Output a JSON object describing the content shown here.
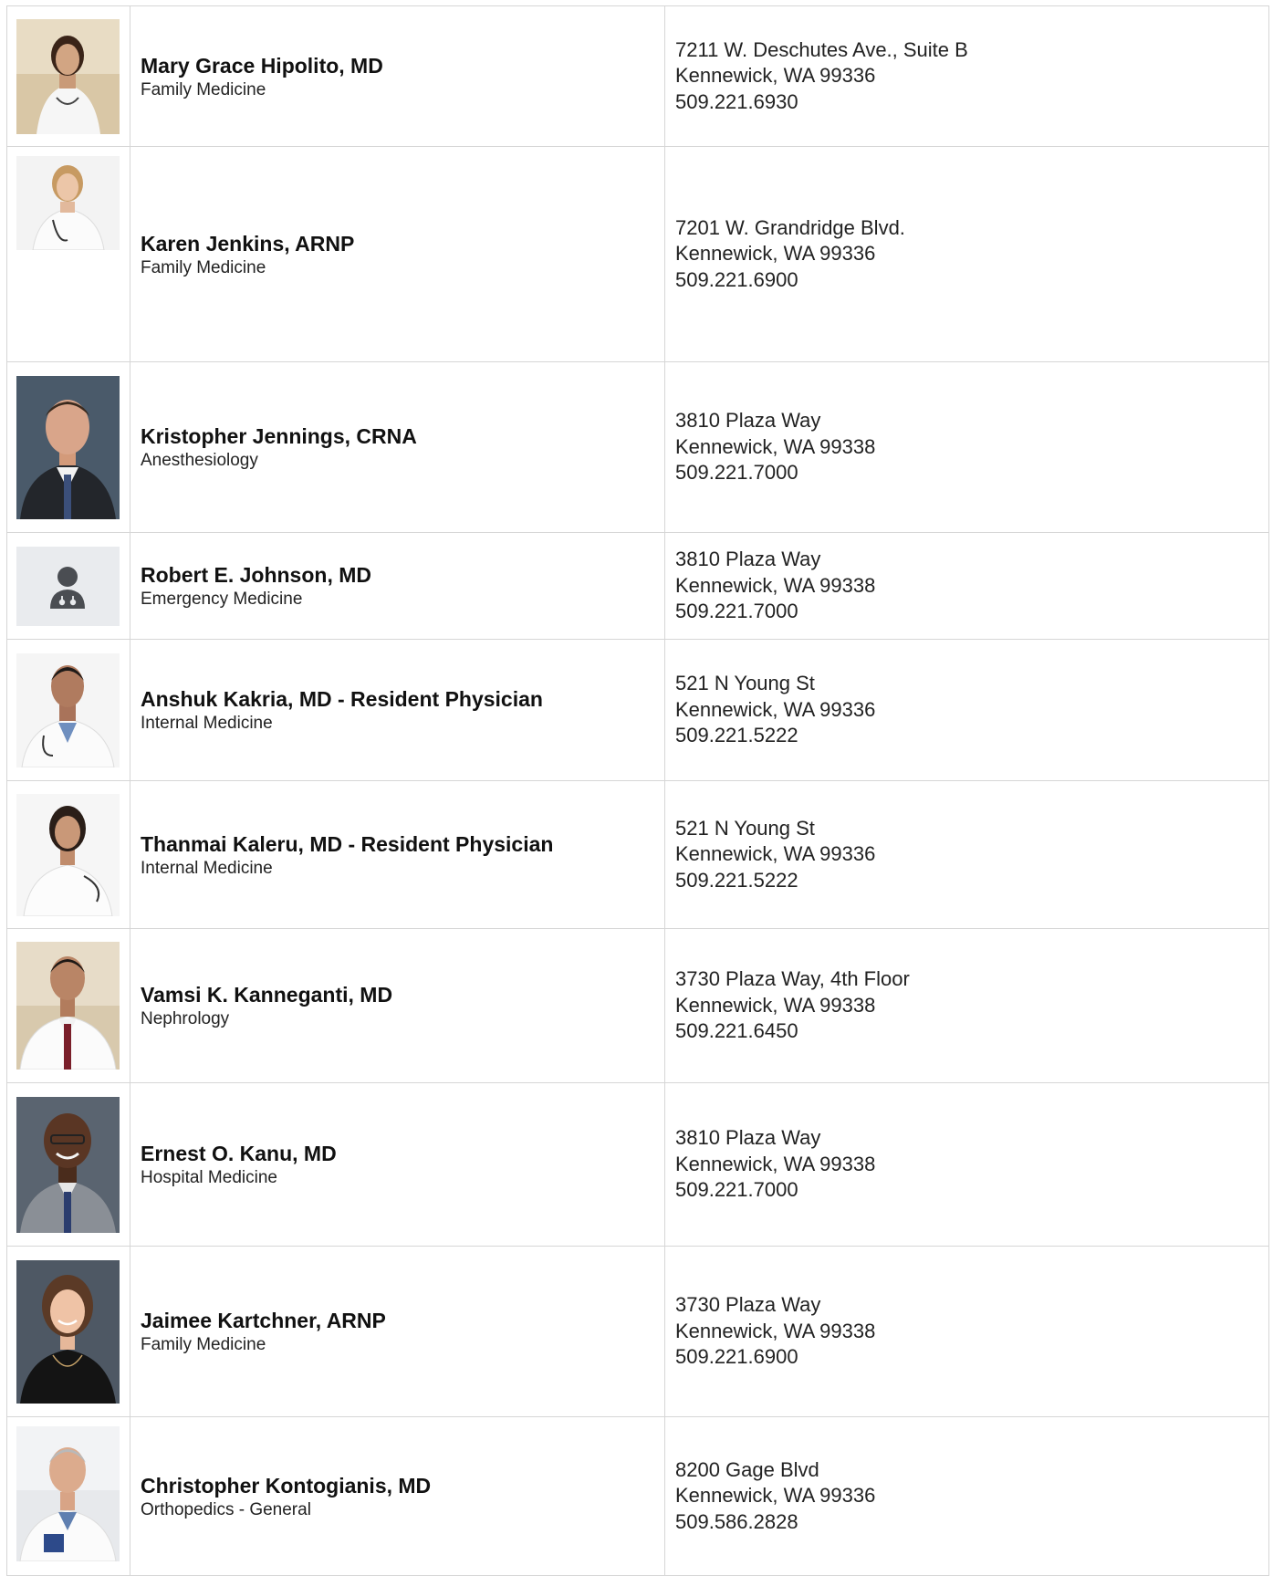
{
  "providers": [
    {
      "name": "Mary Grace Hipolito, MD",
      "specialty": "Family Medicine",
      "address1": "7211 W. Deschutes Ave., Suite B",
      "address2": "Kennewick, WA 99336",
      "phone": "509.221.6930"
    },
    {
      "name": "Karen Jenkins, ARNP",
      "specialty": "Family Medicine",
      "address1": "7201 W. Grandridge Blvd.",
      "address2": "Kennewick, WA 99336",
      "phone": "509.221.6900"
    },
    {
      "name": "Kristopher Jennings, CRNA",
      "specialty": "Anesthesiology",
      "address1": "3810 Plaza Way",
      "address2": "Kennewick, WA 99338",
      "phone": "509.221.7000"
    },
    {
      "name": "Robert E. Johnson, MD",
      "specialty": "Emergency Medicine",
      "address1": "3810 Plaza Way",
      "address2": "Kennewick, WA 99338",
      "phone": "509.221.7000"
    },
    {
      "name": "Anshuk Kakria, MD - Resident Physician",
      "specialty": "Internal Medicine",
      "address1": "521 N Young St",
      "address2": "Kennewick, WA 99336",
      "phone": "509.221.5222"
    },
    {
      "name": "Thanmai Kaleru, MD - Resident Physician",
      "specialty": "Internal Medicine",
      "address1": "521 N Young St",
      "address2": "Kennewick, WA 99336",
      "phone": "509.221.5222"
    },
    {
      "name": "Vamsi K. Kanneganti, MD",
      "specialty": "Nephrology",
      "address1": "3730 Plaza Way, 4th Floor",
      "address2": "Kennewick, WA 99338",
      "phone": "509.221.6450"
    },
    {
      "name": "Ernest O. Kanu, MD",
      "specialty": "Hospital Medicine",
      "address1": "3810 Plaza Way",
      "address2": "Kennewick, WA 99338",
      "phone": "509.221.7000"
    },
    {
      "name": "Jaimee Kartchner, ARNP",
      "specialty": "Family Medicine",
      "address1": "3730 Plaza Way",
      "address2": "Kennewick, WA 99338",
      "phone": "509.221.6900"
    },
    {
      "name": "Christopher Kontogianis, MD",
      "specialty": "Orthopedics - General",
      "address1": "8200 Gage Blvd",
      "address2": "Kennewick, WA 99336",
      "phone": "509.586.2828"
    }
  ],
  "photo_icons": [
    "provider-photo",
    "provider-photo",
    "provider-photo",
    "doctor-placeholder-icon",
    "provider-photo",
    "provider-photo",
    "provider-photo",
    "provider-photo",
    "provider-photo",
    "provider-photo"
  ]
}
